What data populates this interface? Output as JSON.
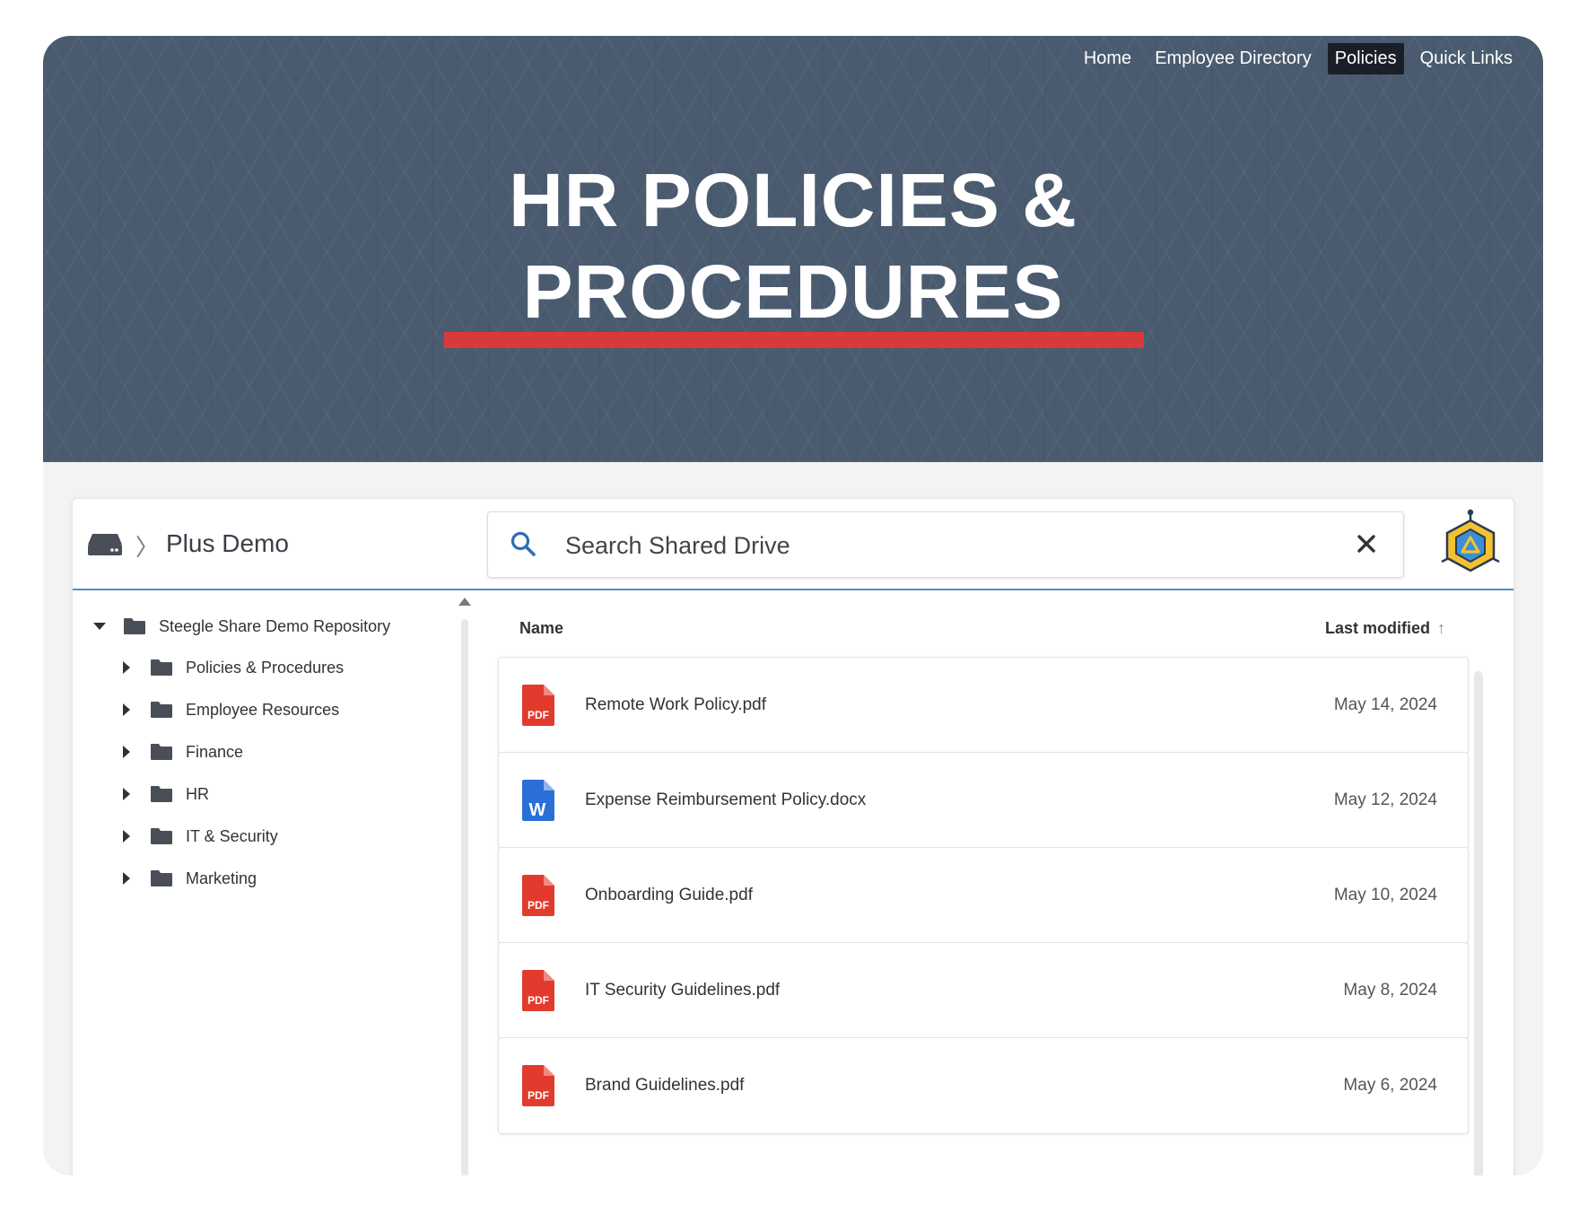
{
  "nav": {
    "items": [
      {
        "label": "Home",
        "active": false
      },
      {
        "label": "Employee Directory",
        "active": false
      },
      {
        "label": "Policies",
        "active": true
      },
      {
        "label": "Quick Links",
        "active": false
      }
    ]
  },
  "hero": {
    "title_line1": "HR POLICIES &",
    "title_line2": "PROCEDURES",
    "bg_color": "#4a5b6f",
    "underline_color": "#d83a3a"
  },
  "toolbar": {
    "breadcrumb_title": "Plus Demo",
    "breadcrumb_separator": "〉",
    "search_placeholder": "Search Shared Drive"
  },
  "sidebar": {
    "root": {
      "label": "Steegle Share Demo Repository",
      "expanded": true
    },
    "folders": [
      {
        "label": "Policies & Procedures"
      },
      {
        "label": "Employee Resources"
      },
      {
        "label": "Finance"
      },
      {
        "label": "HR"
      },
      {
        "label": "IT & Security"
      },
      {
        "label": "Marketing"
      }
    ]
  },
  "filelist": {
    "col_name": "Name",
    "col_modified": "Last modified",
    "sort_arrow": "↑",
    "files": [
      {
        "name": "Remote Work Policy.pdf",
        "date": "May 14, 2024",
        "type": "pdf-icon"
      },
      {
        "name": "Expense Reimbursement Policy.docx",
        "date": "May 12, 2024",
        "type": "word-icon"
      },
      {
        "name": "Onboarding Guide.pdf",
        "date": "May 10, 2024",
        "type": "pdf-icon"
      },
      {
        "name": "IT Security Guidelines.pdf",
        "date": "May 8, 2024",
        "type": "pdf-icon"
      },
      {
        "name": "Brand Guidelines.pdf",
        "date": "May 6, 2024",
        "type": "pdf-icon"
      }
    ]
  },
  "colors": {
    "pdf": "#e23b2e",
    "word": "#2a6fd6",
    "accent_line": "#5a8ac6"
  }
}
